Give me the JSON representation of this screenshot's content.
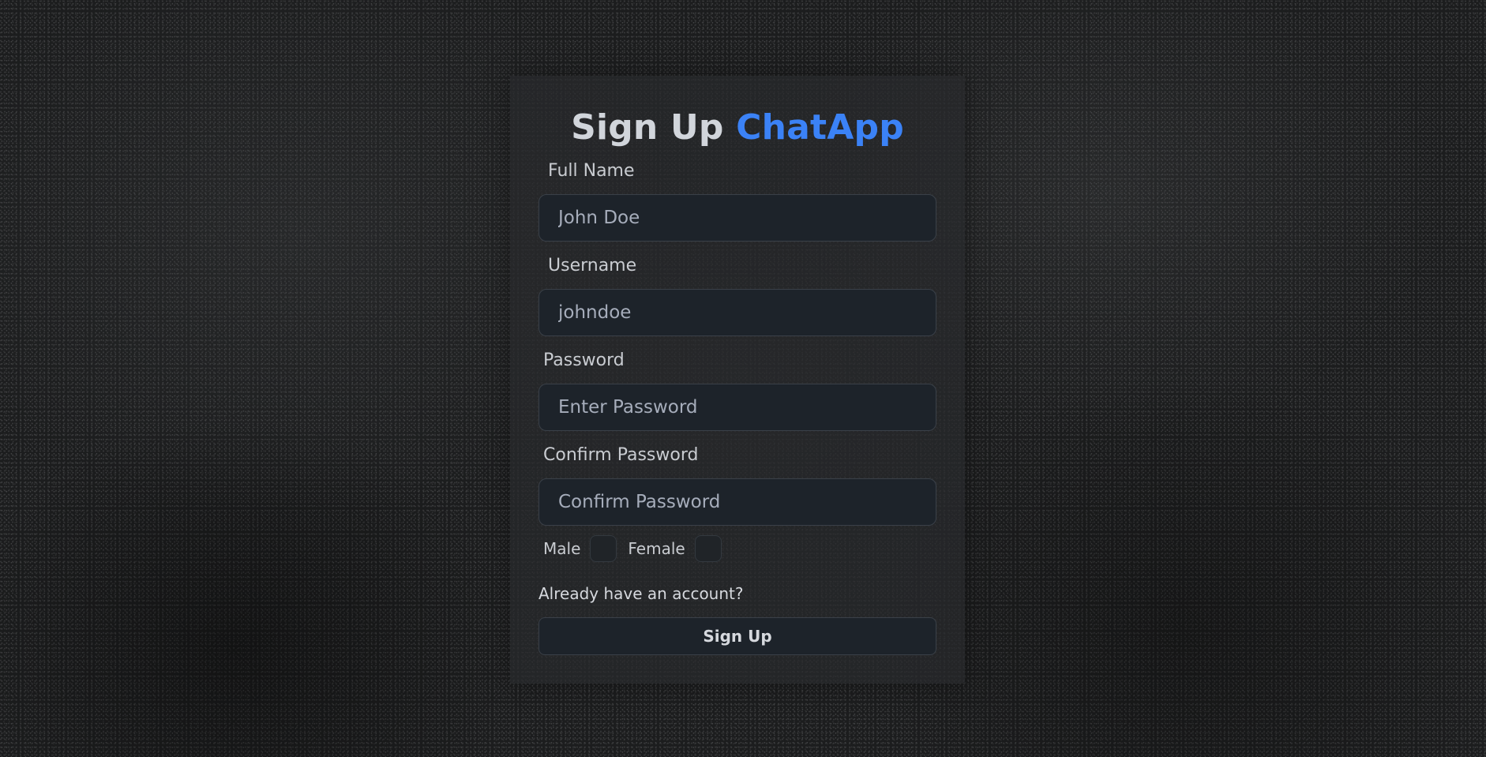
{
  "form": {
    "title_prefix": "Sign Up",
    "title_brand": "ChatApp",
    "brand_color": "#3b82f6",
    "fields": {
      "full_name": {
        "label": "Full Name",
        "placeholder": "John Doe"
      },
      "username": {
        "label": "Username",
        "placeholder": "johndoe"
      },
      "password": {
        "label": "Password",
        "placeholder": "Enter Password"
      },
      "confirm_password": {
        "label": "Confirm Password",
        "placeholder": "Confirm Password"
      }
    },
    "gender": {
      "male_label": "Male",
      "female_label": "Female"
    },
    "login_link": "Already have an account?",
    "submit_label": "Sign Up"
  }
}
